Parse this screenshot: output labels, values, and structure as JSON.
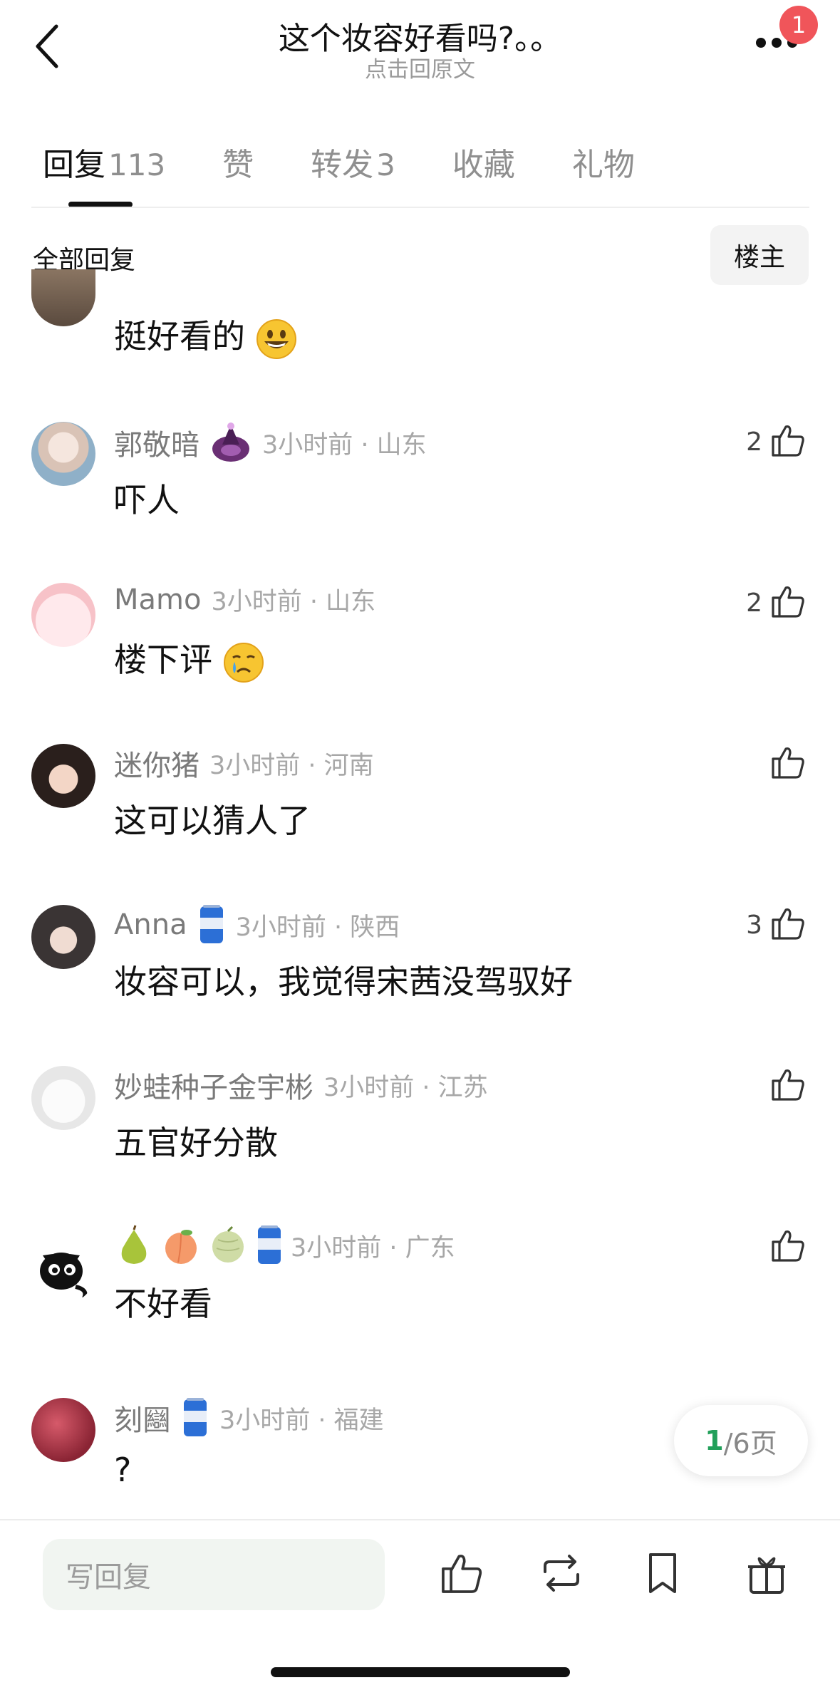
{
  "header": {
    "title": "这个妆容好看吗?。。",
    "subtitle": "点击回原文",
    "notification_count": "1",
    "back_icon": "chevron-left-icon",
    "more_icon": "more-dots-icon"
  },
  "tabs": [
    {
      "label": "回复",
      "count": "113"
    },
    {
      "label": "赞",
      "count": ""
    },
    {
      "label": "转发",
      "count": "3"
    },
    {
      "label": "收藏",
      "count": ""
    },
    {
      "label": "礼物",
      "count": ""
    }
  ],
  "filter": {
    "label": "全部回复",
    "owner_button": "楼主"
  },
  "comments": [
    {
      "name": "",
      "meta": "",
      "text": "挺好看的",
      "emoji": "grinning-face",
      "likes": ""
    },
    {
      "name": "郭敬暗",
      "meta": "3小时前 · 山东",
      "text": "吓人",
      "badge": "purple-fan-badge",
      "likes": "2"
    },
    {
      "name": "Mamo",
      "meta": "3小时前 · 山东",
      "text": "楼下评",
      "emoji": "crying-face",
      "likes": "2"
    },
    {
      "name": "迷你猪",
      "meta": "3小时前 · 河南",
      "text": "这可以猜人了",
      "likes": ""
    },
    {
      "name": "Anna",
      "meta": "3小时前 · 陕西",
      "text": "妆容可以，我觉得宋茜没驾驭好",
      "badge": "blue-can-badge",
      "likes": "3"
    },
    {
      "name": "妙蛙种子金宇彬",
      "meta": "3小时前 · 江苏",
      "text": "五官好分散",
      "likes": ""
    },
    {
      "name": "",
      "meta": "3小时前 · 广东",
      "text": "不好看",
      "name_emojis": [
        "pear",
        "peach",
        "melon"
      ],
      "badge": "blue-can-badge",
      "likes": ""
    },
    {
      "name": "刻圝",
      "meta": "3小时前 · 福建",
      "text": "?",
      "badge": "blue-can-badge",
      "likes": ""
    }
  ],
  "pagination": {
    "current": "1",
    "total": "/6页"
  },
  "bottom_bar": {
    "placeholder": "写回复",
    "icons": [
      "like-icon",
      "repost-icon",
      "bookmark-icon",
      "gift-icon"
    ]
  },
  "colors": {
    "badge_red": "#f0555a",
    "page_green": "#22a05a",
    "input_bg": "#f1f5f1"
  }
}
